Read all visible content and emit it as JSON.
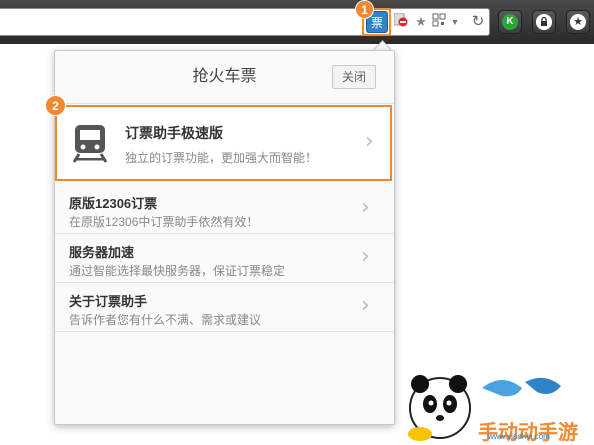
{
  "toolbar": {
    "extension_label": "票",
    "step1": "1",
    "icons": [
      "stop-icon",
      "star-icon",
      "qr-icon",
      "dropdown-icon",
      "refresh-icon",
      "k-icon",
      "lock-icon",
      "star-button-icon"
    ]
  },
  "popup": {
    "title": "抢火车票",
    "close_label": "关闭",
    "step2": "2",
    "featured": {
      "title": "订票助手极速版",
      "desc": "独立的订票功能，更加强大而智能！"
    },
    "items": [
      {
        "title": "原版12306订票",
        "desc": "在原版12306中订票助手依然有效！"
      },
      {
        "title": "服务器加速",
        "desc": "通过智能选择最快服务器，保证订票稳定"
      },
      {
        "title": "关于订票助手",
        "desc": "告诉作者您有什么不满、需求或建议"
      }
    ]
  },
  "watermark": {
    "text": "手动动手游",
    "url": "www.xiaohei.com"
  },
  "colors": {
    "accent": "#f0892f",
    "extension_blue": "#2f83c9"
  }
}
